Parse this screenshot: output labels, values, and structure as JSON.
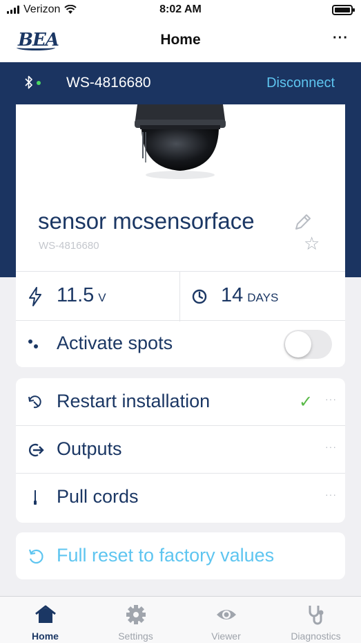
{
  "status_bar": {
    "carrier": "Verizon",
    "time": "8:02 AM"
  },
  "header": {
    "logo_text": "BEA",
    "title": "Home",
    "more_label": "···"
  },
  "connection": {
    "device_id": "WS-4816680",
    "disconnect_label": "Disconnect",
    "status_color": "#4cd964"
  },
  "device": {
    "name": "sensor mcsensorface",
    "serial": "WS-4816680"
  },
  "stats": {
    "voltage": {
      "value": "11.5",
      "unit": "V"
    },
    "uptime": {
      "value": "14",
      "unit": "DAYS"
    }
  },
  "activate_spots": {
    "label": "Activate spots",
    "enabled": false
  },
  "menu": {
    "restart": {
      "label": "Restart installation",
      "check": "✓",
      "dots": "···"
    },
    "outputs": {
      "label": "Outputs",
      "dots": "···"
    },
    "pull_cords": {
      "label": "Pull cords",
      "dots": "···"
    }
  },
  "reset": {
    "label": "Full reset to factory values"
  },
  "tabs": [
    {
      "label": "Home",
      "icon": "home-icon",
      "active": true
    },
    {
      "label": "Settings",
      "icon": "gear-icon",
      "active": false
    },
    {
      "label": "Viewer",
      "icon": "eye-icon",
      "active": false
    },
    {
      "label": "Diagnostics",
      "icon": "stethoscope-icon",
      "active": false
    }
  ],
  "colors": {
    "navy": "#1b3461",
    "text": "#1b3764",
    "accent": "#5ec5f0",
    "success": "#58b947"
  }
}
